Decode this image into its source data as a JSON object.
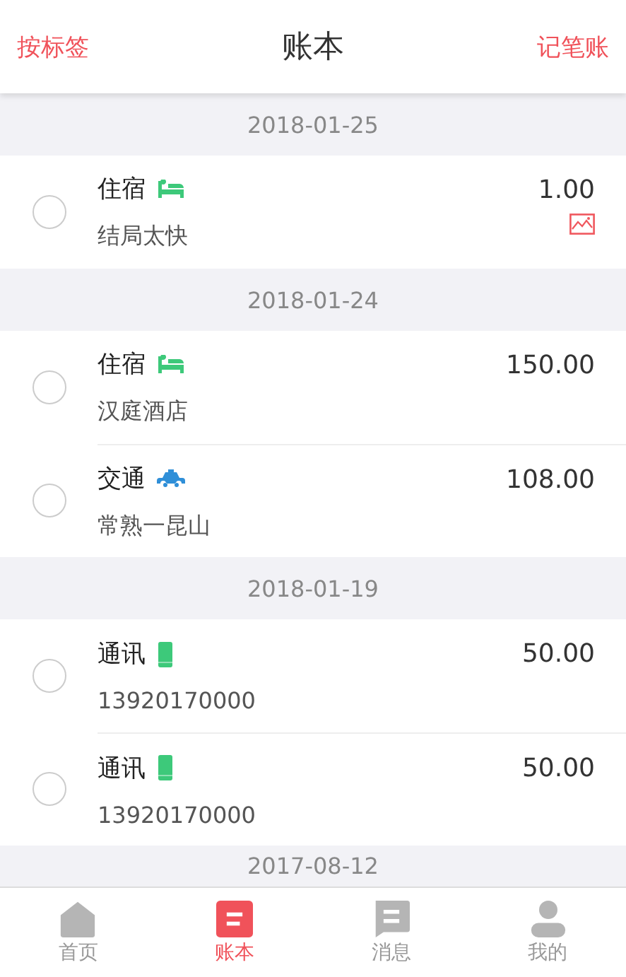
{
  "header": {
    "left_action": "按标签",
    "title": "账本",
    "right_action": "记笔账"
  },
  "groups": [
    {
      "date": "2018-01-25",
      "entries": [
        {
          "category": "住宿",
          "kind": "lodging",
          "note": "结局太快",
          "amount": "1.00",
          "selected": false,
          "has_image": true
        }
      ]
    },
    {
      "date": "2018-01-24",
      "entries": [
        {
          "category": "住宿",
          "kind": "lodging",
          "note": "汉庭酒店",
          "amount": "150.00",
          "selected": false,
          "has_image": false
        },
        {
          "category": "交通",
          "kind": "transport",
          "note": "常熟一昆山",
          "amount": "108.00",
          "selected": false,
          "has_image": false
        }
      ]
    },
    {
      "date": "2018-01-19",
      "entries": [
        {
          "category": "通讯",
          "kind": "phone",
          "note": "13920170000",
          "amount": "50.00",
          "selected": false,
          "has_image": false
        },
        {
          "category": "通讯",
          "kind": "phone",
          "note": "13920170000",
          "amount": "50.00",
          "selected": false,
          "has_image": false
        }
      ]
    },
    {
      "date": "2017-08-12"
    }
  ],
  "tabs": [
    {
      "label": "首页",
      "kind": "home",
      "selected": false
    },
    {
      "label": "账本",
      "kind": "ledger",
      "selected": true
    },
    {
      "label": "消息",
      "kind": "message",
      "selected": false
    },
    {
      "label": "我的",
      "kind": "profile",
      "selected": false
    }
  ]
}
